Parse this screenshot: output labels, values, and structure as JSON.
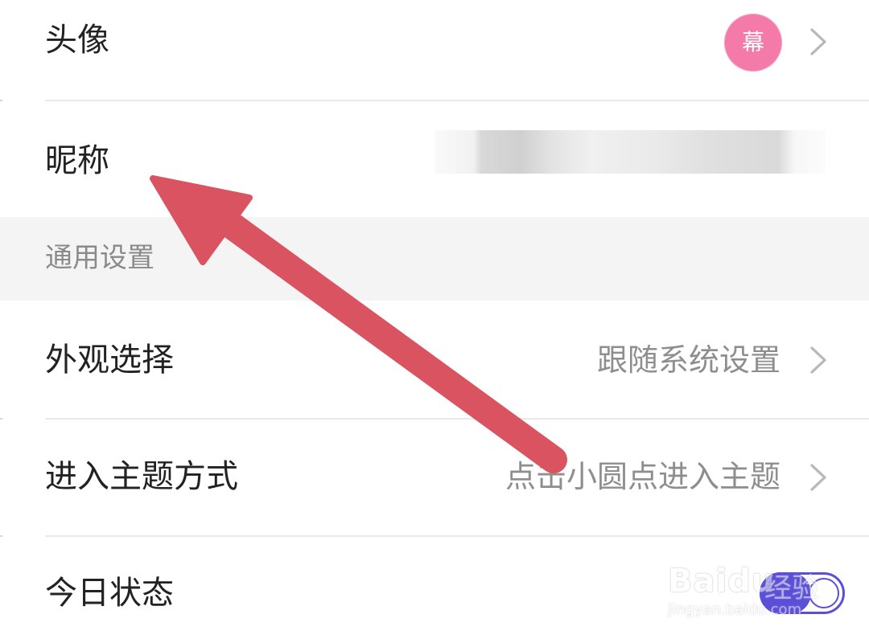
{
  "profile": {
    "avatar_label": "头像",
    "avatar_text": "幕",
    "nickname_label": "昵称"
  },
  "general_settings": {
    "section_title": "通用设置",
    "appearance_label": "外观选择",
    "appearance_value": "跟随系统设置",
    "enter_theme_label": "进入主题方式",
    "enter_theme_value": "点击小圆点进入主题",
    "today_status_label": "今日状态",
    "today_status_enabled": true
  },
  "watermark": {
    "brand": "Baidu",
    "brand_cn": "经验",
    "url": "jingyan.baidu.com"
  },
  "colors": {
    "avatar_bg": "#f47aa9",
    "toggle_on": "#5b4fd9",
    "annotation_arrow": "#d95460",
    "section_bg": "#f4f4f4"
  },
  "icons": {
    "chevron": "chevron-right-icon",
    "annotation": "red-arrow-icon"
  }
}
